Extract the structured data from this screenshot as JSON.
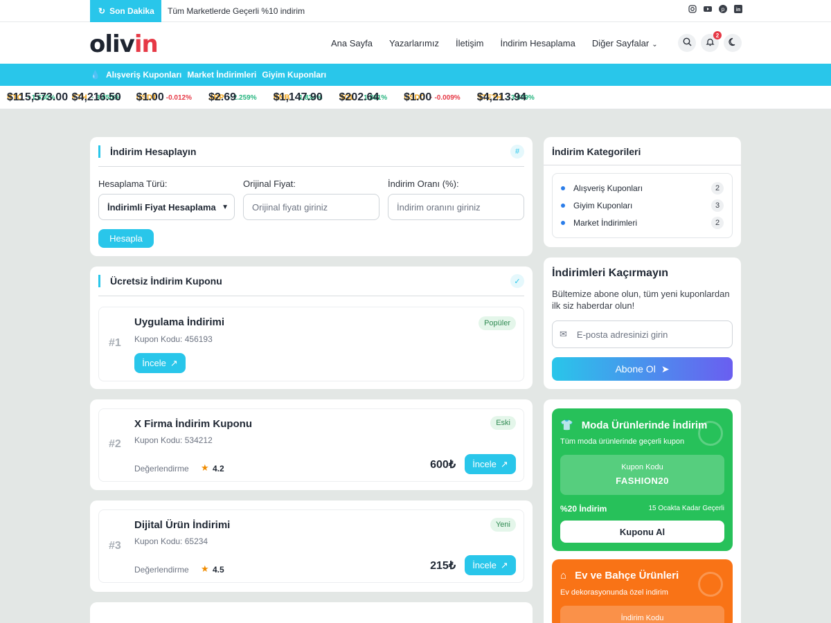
{
  "topbar": {
    "breaking_label": "Son Dakika",
    "breaking_text": "Tüm Marketlerde Geçerli %10 indirim",
    "socials": [
      "instagram-icon",
      "youtube-icon",
      "pinterest-icon",
      "linkedin-icon"
    ]
  },
  "header": {
    "logo_main": "oliv",
    "logo_accent": "in",
    "nav": [
      "Ana Sayfa",
      "Yazarlarımız",
      "İletişim",
      "İndirim Hesaplama",
      "Diğer Sayfalar"
    ],
    "notification_count": "2"
  },
  "category_links": [
    "Alışveriş Kuponları",
    "Market İndirimleri",
    "Giyim Kuponları"
  ],
  "ticker": [
    {
      "sym": "BTC",
      "price": "$115,573.00",
      "chg": "1.630%",
      "dir": "up"
    },
    {
      "sym": "ETH",
      "price": "$4,216.50",
      "chg": "3.850%",
      "dir": "up"
    },
    {
      "sym": "USDT",
      "price": "$1.00",
      "chg": "-0.012%",
      "dir": "down"
    },
    {
      "sym": "XRP",
      "price": "$2.69",
      "chg": "2.259%",
      "dir": "up"
    },
    {
      "sym": "BNB",
      "price": "$1,147.90",
      "chg": "1.834%",
      "dir": "up"
    },
    {
      "sym": "SOL",
      "price": "$202.64",
      "chg": "1.881%",
      "dir": "up"
    },
    {
      "sym": "USDC",
      "price": "$1.00",
      "chg": "-0.009%",
      "dir": "down"
    },
    {
      "sym": "STETH",
      "price": "$4,213.94",
      "chg": "3.879%",
      "dir": "up"
    }
  ],
  "calculator": {
    "title": "İndirim Hesaplayın",
    "type_label": "Hesaplama Türü:",
    "type_value": "İndirimli Fiyat Hesaplama",
    "price_label": "Orijinal Fiyat:",
    "price_placeholder": "Orijinal fiyatı giriniz",
    "rate_label": "İndirim Oranı (%):",
    "rate_placeholder": "İndirim oranını giriniz",
    "button": "Hesapla"
  },
  "free_coupon": {
    "title": "Ücretsiz İndirim Kuponu",
    "rank": "#1",
    "name": "Uygulama İndirimi",
    "code": "Kupon Kodu: 456193",
    "tag": "Popüler",
    "button": "İncele"
  },
  "coupons": [
    {
      "rank": "#2",
      "name": "X Firma İndirim Kuponu",
      "code": "Kupon Kodu: 534212",
      "tag": "Eski",
      "rating_label": "Değerlendirme",
      "rating": "4.2",
      "price": "600₺",
      "button": "İncele"
    },
    {
      "rank": "#3",
      "name": "Dijital Ürün İndirimi",
      "code": "Kupon Kodu: 65234",
      "tag": "Yeni",
      "rating_label": "Değerlendirme",
      "rating": "4.5",
      "price": "215₺",
      "button": "İncele"
    }
  ],
  "categories": {
    "title": "İndirim Kategorileri",
    "items": [
      {
        "label": "Alışveriş Kuponları",
        "count": "2"
      },
      {
        "label": "Giyim Kuponları",
        "count": "3"
      },
      {
        "label": "Market İndirimleri",
        "count": "2"
      }
    ]
  },
  "newsletter": {
    "title": "İndirimleri Kaçırmayın",
    "desc": "Bültemize abone olun, tüm yeni kuponlardan ilk siz haberdar olun!",
    "placeholder": "E-posta adresinizi girin",
    "button": "Abone Ol"
  },
  "promos": [
    {
      "title": "Moda Ürünlerinde İndirim",
      "sub": "Tüm moda ürünlerinde geçerli kupon",
      "code_label": "Kupon Kodu",
      "code": "FASHION20",
      "pct": "%20 İndirim",
      "expiry": "15 Ocakta Kadar Geçerli",
      "button": "Kuponu Al",
      "color": "#27c15a",
      "icon": "shirt-icon"
    },
    {
      "title": "Ev ve Bahçe Ürünleri",
      "sub": "Ev dekorasyonunda özel indirim",
      "code_label": "İndirim Kodu",
      "color": "#f97316",
      "icon": "home-icon"
    }
  ],
  "colors": {
    "accent": "#29c6ea",
    "brand_red": "#e63946",
    "up": "#24b47e",
    "down": "#e63946"
  }
}
